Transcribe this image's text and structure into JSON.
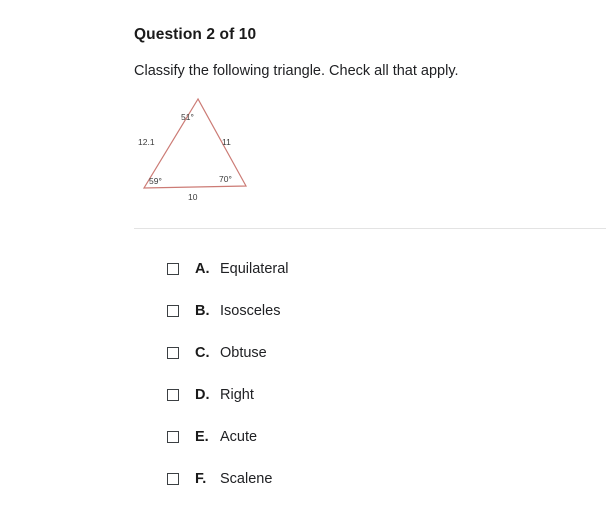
{
  "question": {
    "title": "Question 2 of 10",
    "prompt": "Classify the following triangle. Check all that apply."
  },
  "figure": {
    "type": "triangle-diagram",
    "stroke_color": "#cc7b75",
    "label_color": "#3a3a3a",
    "angles": {
      "apex": "51°",
      "bottom_left": "59°",
      "bottom_right": "70°"
    },
    "sides": {
      "left": "12.1",
      "right": "11",
      "base": "10"
    }
  },
  "options": [
    {
      "letter": "A.",
      "label": "Equilateral",
      "checked": false
    },
    {
      "letter": "B.",
      "label": "Isosceles",
      "checked": false
    },
    {
      "letter": "C.",
      "label": "Obtuse",
      "checked": false
    },
    {
      "letter": "D.",
      "label": "Right",
      "checked": false
    },
    {
      "letter": "E.",
      "label": "Acute",
      "checked": false
    },
    {
      "letter": "F.",
      "label": "Scalene",
      "checked": false
    }
  ]
}
